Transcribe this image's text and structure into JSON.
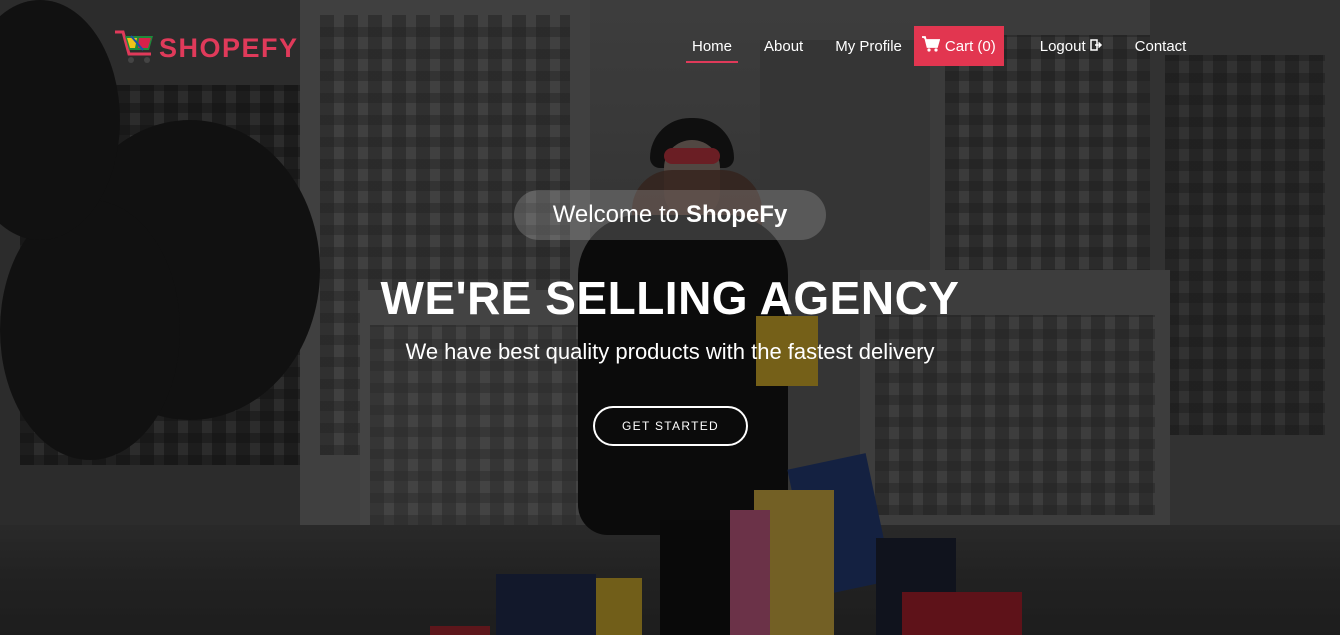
{
  "brand": {
    "name": "SHOPEFY",
    "color": "#e03a5a"
  },
  "nav": {
    "home": "Home",
    "about": "About",
    "profile": "My Profile",
    "cart": "Cart (0)",
    "logout": "Logout",
    "contact": "Contact",
    "active": "home"
  },
  "hero": {
    "welcome_prefix": "Welcome to",
    "welcome_brand": "ShopeFy",
    "headline": "WE'RE SELLING AGENCY",
    "subline": "We have best quality products with the fastest delivery",
    "cta": "GET STARTED"
  },
  "colors": {
    "accent": "#e23650",
    "text": "#ffffff"
  },
  "icons": {
    "cart": "cart-icon",
    "logout": "logout-icon",
    "logo": "shopping-cart-logo-icon"
  }
}
